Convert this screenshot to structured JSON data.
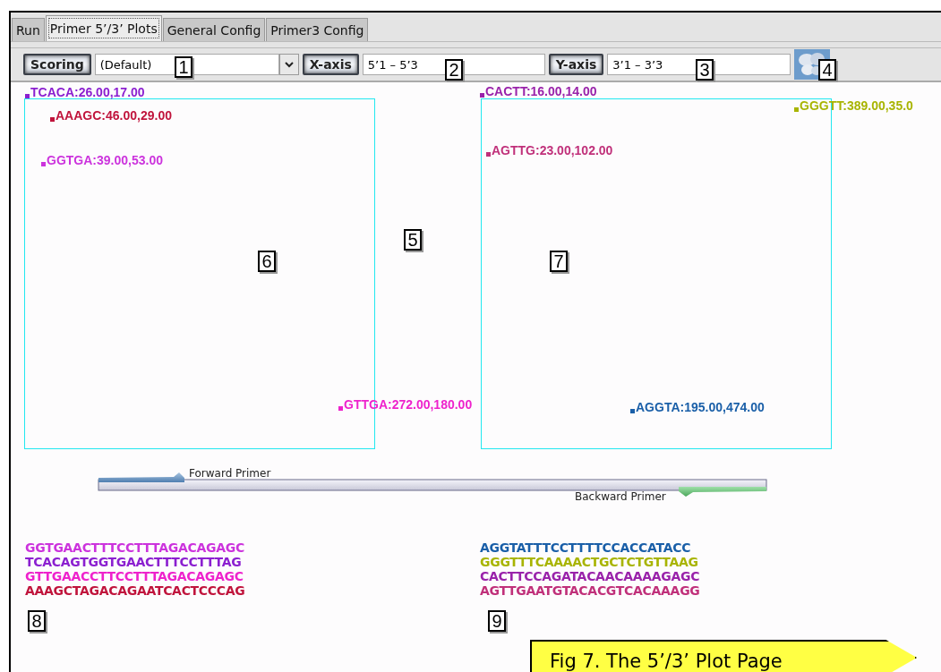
{
  "tabs": [
    {
      "label": "Run",
      "selected": false
    },
    {
      "label": "Primer 5’/3’ Plots",
      "selected": true
    },
    {
      "label": "General Config",
      "selected": false
    },
    {
      "label": "Primer3 Config",
      "selected": false
    }
  ],
  "toolbar": {
    "scoring": {
      "label": "Scoring",
      "value": "(Default)"
    },
    "x_axis": {
      "label": "X-axis",
      "value": "5’1 – 5’3"
    },
    "y_axis": {
      "label": "Y-axis",
      "value": "3’1 – 3’3"
    }
  },
  "plots": [
    {
      "points": [
        {
          "label": "TCACA:26.00,17.00",
          "color": "#8b1fd0"
        },
        {
          "label": "AAAGC:46.00,29.00",
          "color": "#c0143c"
        },
        {
          "label": "GGTGA:39.00,53.00",
          "color": "#cc33dd"
        },
        {
          "label": "GTTGA:272.00,180.00",
          "color": "#ee22cc"
        }
      ]
    },
    {
      "points": [
        {
          "label": "CACTT:16.00,14.00",
          "color": "#9922aa"
        },
        {
          "label": "AGTTG:23.00,102.00",
          "color": "#c0307a"
        },
        {
          "label": "GGGTT:389.00,35.0",
          "color": "#a8b400"
        },
        {
          "label": "AGGTA:195.00,474.00",
          "color": "#1a5fa8"
        }
      ]
    }
  ],
  "primer_diagram": {
    "forward": "Forward Primer",
    "backward": "Backward Primer"
  },
  "sequences": [
    {
      "rows": [
        {
          "text": "GGTGAACTTTCCTTTAGACAGAGC",
          "color": "#cc33dd"
        },
        {
          "text": "TCACAGTGGTGAACTTTCCTTTAG",
          "color": "#8b1fd0"
        },
        {
          "text": "GTTGAACCTTCCTTTAGACAGAGC",
          "color": "#ee22cc"
        },
        {
          "text": "AAAGCTAGACAGAATCACTCCCAG",
          "color": "#c0143c"
        }
      ]
    },
    {
      "rows": [
        {
          "text": "AGGTATTTCCTTTTCCACCATACC",
          "color": "#1a5fa8"
        },
        {
          "text": "GGGTTTCAAAACTGCTCTGTTAAG",
          "color": "#a8b400"
        },
        {
          "text": "CACTTCCAGATACAACAAAAGAGC",
          "color": "#9922aa"
        },
        {
          "text": "AGTTGAATGTACACGTCACAAAGG",
          "color": "#c0307a"
        }
      ]
    }
  ],
  "callouts": [
    "1",
    "2",
    "3",
    "4",
    "5",
    "6",
    "7",
    "8",
    "9"
  ],
  "caption": "Fig 7. The 5’/3’ Plot Page"
}
